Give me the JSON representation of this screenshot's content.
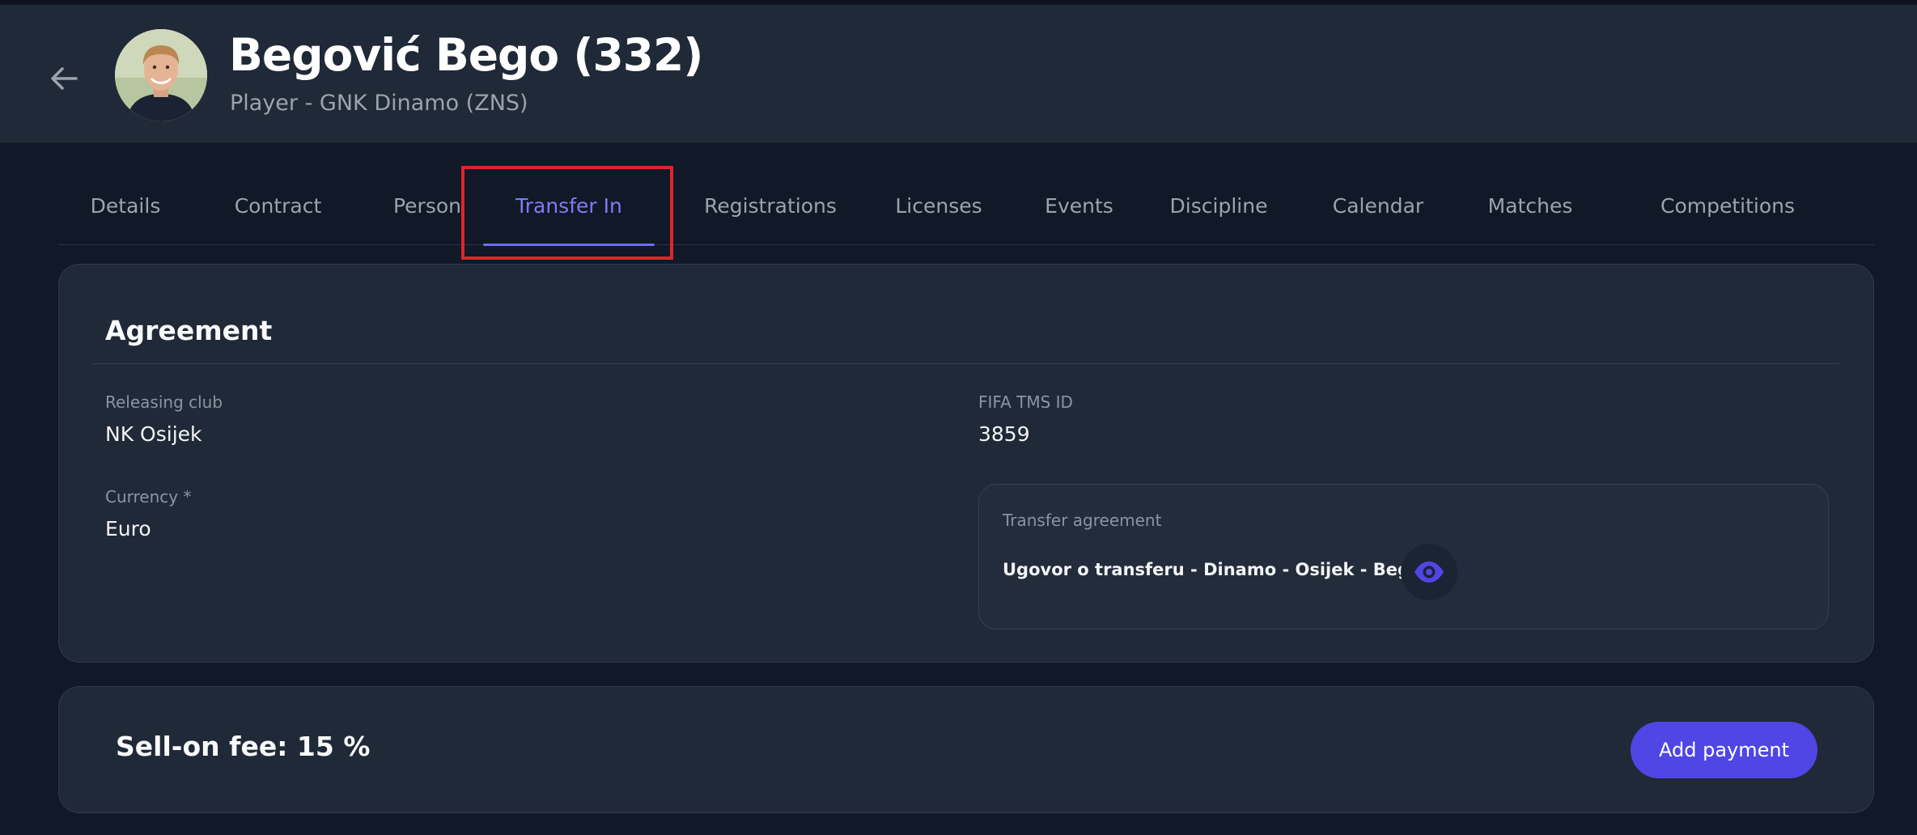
{
  "header": {
    "title": "Begović  Bego (332)",
    "subtitle": "Player - GNK Dinamo (ZNS)",
    "back_icon": "arrow-left-icon"
  },
  "tabs": [
    {
      "label": "Details",
      "active": false
    },
    {
      "label": "Contract",
      "active": false
    },
    {
      "label": "Person",
      "active": false
    },
    {
      "label": "Transfer In",
      "active": true
    },
    {
      "label": "Registrations",
      "active": false
    },
    {
      "label": "Licenses",
      "active": false
    },
    {
      "label": "Events",
      "active": false
    },
    {
      "label": "Discipline",
      "active": false
    },
    {
      "label": "Calendar",
      "active": false
    },
    {
      "label": "Matches",
      "active": false
    },
    {
      "label": "Competitions",
      "active": false
    }
  ],
  "agreement": {
    "title": "Agreement",
    "releasing_club_label": "Releasing club",
    "releasing_club_value": "NK Osijek",
    "fifa_tms_label": "FIFA TMS ID",
    "fifa_tms_value": "3859",
    "currency_label": "Currency *",
    "currency_value": "Euro",
    "transfer_agreement_label": "Transfer agreement",
    "transfer_agreement_name": "Ugovor o transferu - Dinamo - Osijek - Begović",
    "view_icon": "eye-icon"
  },
  "sellon": {
    "text": "Sell-on fee: 15 %",
    "add_payment_label": "Add payment"
  },
  "colors": {
    "accent": "#4f46e5",
    "active_tab": "#7c7cf4",
    "highlight": "#e0242a"
  }
}
